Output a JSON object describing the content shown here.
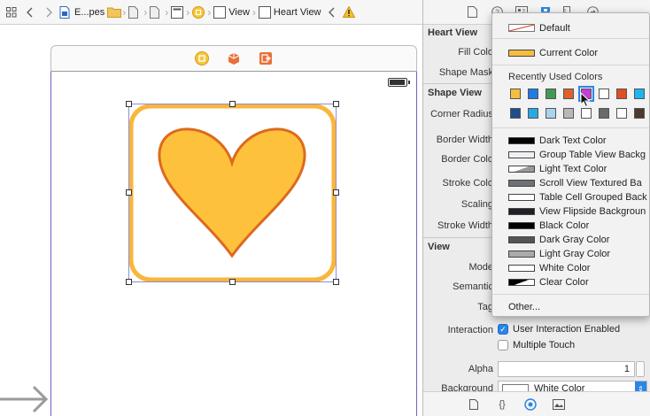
{
  "jumpbar": {
    "breadcrumb_project": "E...pes",
    "breadcrumb_view": "View",
    "breadcrumb_heart": "Heart View"
  },
  "inspector": {
    "heart_section": {
      "title": "Heart View",
      "fill_label": "Fill Colo",
      "shape_mask_label": "Shape Mask"
    },
    "shape_section": {
      "title": "Shape View",
      "corner_radius_label": "Corner Radius",
      "border_width_label": "Border Width",
      "border_color_label": "Border Colo",
      "stroke_color_label": "Stroke Colo",
      "scaling_label": "Scaling",
      "stroke_width_label": "Stroke Width"
    },
    "view_section": {
      "title": "View",
      "mode_label": "Mode",
      "semantic_label": "Semantic",
      "tag_label": "Tag",
      "interaction_label": "Interaction",
      "user_interaction_label": "User Interaction Enabled",
      "user_interaction_checked": true,
      "multiple_touch_label": "Multiple Touch",
      "multiple_touch_checked": false,
      "alpha_label": "Alpha",
      "alpha_value": "1",
      "background_label": "Background",
      "background_value": "White Color"
    }
  },
  "color_popup": {
    "default_label": "Default",
    "current_color_label": "Current Color",
    "current_color": "#f7bd3e",
    "recent_heading": "Recently Used Colors",
    "recent_colors_row1": [
      "#f7bd3e",
      "#1f7be6",
      "#3f9a51",
      "#e0602a",
      "#c040d8",
      "#ffffff",
      "#e04e21",
      "#1fb4ee"
    ],
    "recent_colors_row2": [
      "#1f4f8a",
      "#29a8e6",
      "#a8d4f0",
      "#b8b8b8",
      "#ffffff",
      "#6a6a6a",
      "#ffffff",
      "#4a3a30"
    ],
    "selected_recent_index": 4,
    "named_colors": [
      {
        "label": "Dark Text Color",
        "color": "#000000"
      },
      {
        "label": "Group Table View Backg",
        "color": "#efeff4"
      },
      {
        "label": "Light Text Color",
        "color": "#999999"
      },
      {
        "label": "Scroll View Textured Ba",
        "color": "#6f7179"
      },
      {
        "label": "Table Cell Grouped Back",
        "color": "#ffffff"
      },
      {
        "label": "View Flipside Backgroun",
        "color": "#1f2124"
      },
      {
        "label": "Black Color",
        "color": "#000000"
      },
      {
        "label": "Dark Gray Color",
        "color": "#555555"
      },
      {
        "label": "Light Gray Color",
        "color": "#aaaaaa"
      },
      {
        "label": "White Color",
        "color": "#ffffff"
      },
      {
        "label": "Clear Color",
        "color": "#000000"
      }
    ],
    "other_label": "Other..."
  },
  "colors": {
    "heart_fill": "#fec13b",
    "heart_stroke": "#dc6a1f",
    "border": "#f9b63a",
    "accent": "#2c86e6"
  }
}
